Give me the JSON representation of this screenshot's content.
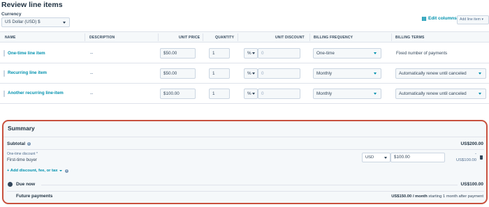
{
  "page_title": "Review line items",
  "currency": {
    "label": "Currency",
    "selected": "US Dollar (USD) $"
  },
  "toolbar": {
    "edit_columns": "Edit columns",
    "add_line_item": "Add line item"
  },
  "columns": [
    "NAME",
    "DESCRIPTION",
    "UNIT PRICE",
    "QUANTITY",
    "UNIT DISCOUNT",
    "BILLING FREQUENCY",
    "BILLING TERMS"
  ],
  "line_items": [
    {
      "name": "One-time line item",
      "description": "--",
      "unit_price": "$50.00",
      "quantity": "1",
      "discount_type": "%",
      "discount_value": "0",
      "billing_frequency": "One-time",
      "billing_terms": "Fixed number of payments"
    },
    {
      "name": "Recurring line item",
      "description": "--",
      "unit_price": "$50.00",
      "quantity": "1",
      "discount_type": "%",
      "discount_value": "0",
      "billing_frequency": "Monthly",
      "billing_terms": "Automatically renew until canceled"
    },
    {
      "name": "Another recurring line-item",
      "description": "--",
      "unit_price": "$100.00",
      "quantity": "1",
      "discount_type": "%",
      "discount_value": "0",
      "billing_frequency": "Monthly",
      "billing_terms": "Automatically renew until canceled"
    }
  ],
  "summary": {
    "title": "Summary",
    "subtotal_label": "Subtotal",
    "subtotal_value": "US$200.00",
    "discount": {
      "label": "One-time discount *",
      "name": "First-time buyer",
      "currency": "USD",
      "amount": "$100.00",
      "dash": "-",
      "value": "US$100.00"
    },
    "add_discount": "+ Add discount, fee, or tax",
    "due_now_label": "Due now",
    "due_now_value": "US$100.00",
    "future_label": "Future payments",
    "future_amount": "US$150.00 / month",
    "future_note": "starting 1 month after payment"
  },
  "colors": {
    "accent": "#0091ae",
    "highlight_border": "#c8513e",
    "text": "#33475b"
  }
}
